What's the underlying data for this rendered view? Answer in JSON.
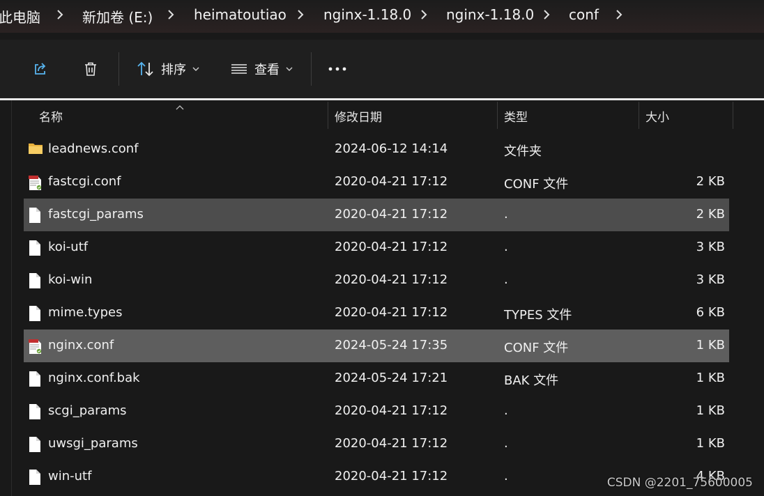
{
  "breadcrumb": {
    "items": [
      "此电脑",
      "新加卷 (E:)",
      "heimatoutiao",
      "nginx-1.18.0",
      "nginx-1.18.0",
      "conf"
    ]
  },
  "toolbar": {
    "sort_label": "排序",
    "view_label": "查看"
  },
  "columns": {
    "name": "名称",
    "date": "修改日期",
    "type": "类型",
    "size": "大小"
  },
  "files": [
    {
      "name": "leadnews.conf",
      "date": "2024-06-12 14:14",
      "type": "文件夹",
      "size": "",
      "icon": "folder-icon"
    },
    {
      "name": "fastcgi.conf",
      "date": "2020-04-21 17:12",
      "type": "CONF 文件",
      "size": "2 KB",
      "icon": "conf-file-icon"
    },
    {
      "name": "fastcgi_params",
      "date": "2020-04-21 17:12",
      "type": ".",
      "size": "2 KB",
      "icon": "file-icon"
    },
    {
      "name": "koi-utf",
      "date": "2020-04-21 17:12",
      "type": ".",
      "size": "3 KB",
      "icon": "file-icon"
    },
    {
      "name": "koi-win",
      "date": "2020-04-21 17:12",
      "type": ".",
      "size": "3 KB",
      "icon": "file-icon"
    },
    {
      "name": "mime.types",
      "date": "2020-04-21 17:12",
      "type": "TYPES 文件",
      "size": "6 KB",
      "icon": "file-icon"
    },
    {
      "name": "nginx.conf",
      "date": "2024-05-24 17:35",
      "type": "CONF 文件",
      "size": "1 KB",
      "icon": "conf-file-icon"
    },
    {
      "name": "nginx.conf.bak",
      "date": "2024-05-24 17:21",
      "type": "BAK 文件",
      "size": "1 KB",
      "icon": "file-icon"
    },
    {
      "name": "scgi_params",
      "date": "2020-04-21 17:12",
      "type": ".",
      "size": "1 KB",
      "icon": "file-icon"
    },
    {
      "name": "uwsgi_params",
      "date": "2020-04-21 17:12",
      "type": ".",
      "size": "1 KB",
      "icon": "file-icon"
    },
    {
      "name": "win-utf",
      "date": "2020-04-21 17:12",
      "type": ".",
      "size": "4 KB",
      "icon": "file-icon"
    }
  ],
  "watermark": "CSDN @2201_75600005",
  "colors": {
    "accent": "#4cc2ff",
    "selected_row": "#4d4d4d",
    "folder": "#f2c55c"
  }
}
